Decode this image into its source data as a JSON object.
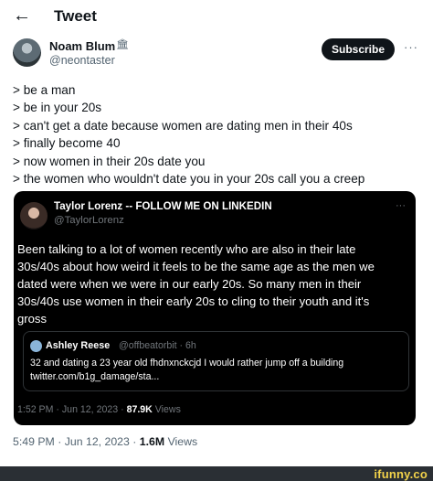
{
  "header": {
    "back_icon": "back-arrow-icon",
    "title": "Tweet"
  },
  "author": {
    "name": "Noam Blum",
    "badge_icon": "institution-badge-icon",
    "handle": "@neontaster",
    "subscribe_label": "Subscribe",
    "more_icon": "more-horizontal-icon"
  },
  "tweet": {
    "lines": [
      "> be a man",
      "> be in your 20s",
      "> can't get a date because women are dating men in their 40s",
      "> finally become 40",
      "> now women in their 20s date you",
      "> the women who wouldn't date you in your 20s call you a creep"
    ],
    "time": "5:49 PM",
    "date": "Jun 12, 2023",
    "views_count": "1.6M",
    "views_label": "Views"
  },
  "quote": {
    "name": "Taylor Lorenz -- FOLLOW ME ON LINKEDIN",
    "handle": "@TaylorLorenz",
    "more": "···",
    "lines": [
      "Been talking to a lot of women recently who are also in their late",
      "30s/40s about how weird it feels to be the same age as the men we",
      "dated were when we were in our early 20s. So many men in their",
      "30s/40s use women in their early 20s to cling to their youth and it's",
      "gross"
    ],
    "nested": {
      "name": "Ashley Reese",
      "handle": "@offbeatorbit · 6h",
      "lines": [
        "32 and dating a 23 year old fhdnxnckcjd I would rather jump off a building",
        "twitter.com/b1g_damage/sta..."
      ]
    },
    "time": "1:52 PM",
    "date": "Jun 12, 2023",
    "views_count": "87.9K",
    "views_label": "Views"
  },
  "watermark": "ifunny.co",
  "colors": {
    "text": "#0f1419",
    "secondary": "#536471",
    "quote_bg": "#000000",
    "watermark": "#f2d24a"
  }
}
